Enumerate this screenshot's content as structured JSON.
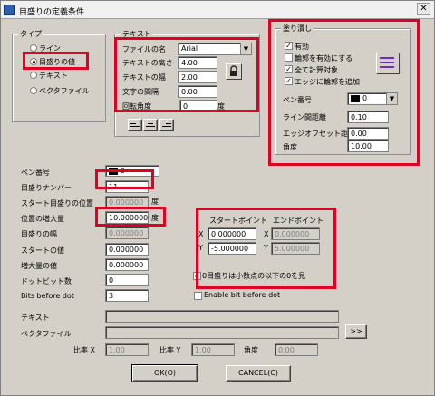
{
  "window": {
    "title": "目盛りの定義条件",
    "close_glyph": "✕"
  },
  "type_group": {
    "label": "タイプ",
    "options": [
      "ライン",
      "目盛りの値",
      "テキスト",
      "ベクタファイル"
    ],
    "selected": 1
  },
  "text_group": {
    "label": "テキスト",
    "font_label": "ファイルの名",
    "font_value": "Arial",
    "height_label": "テキストの高さ",
    "height_value": "4.00",
    "width_label": "テキストの幅",
    "width_value": "2.00",
    "spacing_label": "文字の間隔",
    "spacing_value": "0.00",
    "rotation_label": "回転角度",
    "rotation_value": "0",
    "rotation_unit": "度"
  },
  "fill_group": {
    "label": "塗り潰し",
    "enabled_label": "有効",
    "outline_label": "輪郭を有効にする",
    "full_calc_label": "全て計算対象",
    "edge_label": "エッジに輪郭を追加",
    "pen_label": "ペン番号",
    "pen_value": "0",
    "line_spacing_label": "ライン間距離",
    "line_spacing_value": "0.10",
    "edge_offset_label": "エッジオフセット距離",
    "edge_offset_value": "0.00",
    "angle_label": "角度",
    "angle_value": "10.00"
  },
  "main": {
    "pen_label": "ペン番号",
    "pen_value": "0",
    "scale_number_label": "目盛りナンバー",
    "scale_number_value": "11",
    "start_pos_label": "スタート目盛りの位置",
    "start_pos_value": "0.000000",
    "start_pos_unit": "度",
    "increment_label": "位置の増大量",
    "increment_value": "10.000000",
    "increment_unit": "度",
    "width_label": "目盛りの幅",
    "width_value": "0.000000",
    "start_value_label": "スタートの値",
    "start_value_value": "0.000000",
    "increase_label": "増大量の値",
    "increase_value": "0.000000",
    "dot_bits_label": "ドットビット数",
    "dot_bits_value": "0",
    "bits_before_label": "Bits before dot",
    "bits_before_value": "3"
  },
  "points": {
    "start_label": "スタートポイント",
    "end_label": "エンドポイント",
    "x_label": "X",
    "y_label": "Y",
    "start_x": "0.000000",
    "start_y": "-5.000000",
    "end_x": "0.000000",
    "end_y": "5.000000",
    "zero_hide_label": "0目盛りは小数点の以下の0を見",
    "enable_bit_label": "Enable bit before dot"
  },
  "bottom": {
    "text_label": "テキスト",
    "vector_label": "ベクタファイル",
    "browse_label": ">>",
    "ratio_x_label": "比率 X",
    "ratio_x_value": "1.00",
    "ratio_y_label": "比率 Y",
    "ratio_y_value": "1.00",
    "angle_label": "角度",
    "angle_value": "0.00",
    "ok_label": "OK(O)",
    "cancel_label": "CANCEL(C)"
  }
}
